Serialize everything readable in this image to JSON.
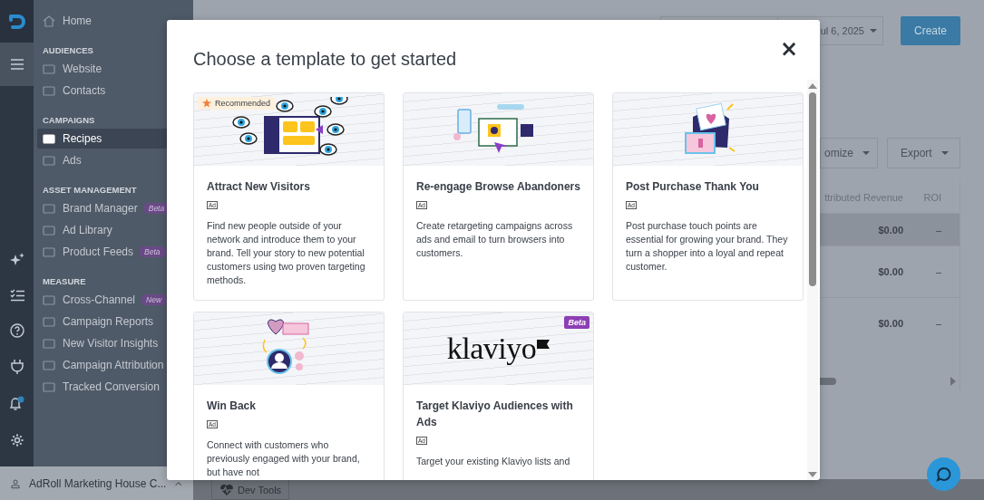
{
  "sidebar": {
    "home": "Home",
    "sections": [
      {
        "title": "AUDIENCES",
        "items": [
          {
            "label": "Website",
            "selected": false
          },
          {
            "label": "Contacts",
            "selected": false
          }
        ]
      },
      {
        "title": "CAMPAIGNS",
        "items": [
          {
            "label": "Recipes",
            "selected": true
          },
          {
            "label": "Ads",
            "selected": false
          }
        ]
      },
      {
        "title": "ASSET MANAGEMENT",
        "items": [
          {
            "label": "Brand Manager",
            "selected": false,
            "badge": "Beta"
          },
          {
            "label": "Ad Library",
            "selected": false
          },
          {
            "label": "Product Feeds",
            "selected": false,
            "badge": "Beta"
          }
        ]
      },
      {
        "title": "MEASURE",
        "items": [
          {
            "label": "Cross-Channel",
            "selected": false,
            "badge": "New"
          },
          {
            "label": "Campaign Reports",
            "selected": false
          },
          {
            "label": "New Visitor Insights",
            "selected": false
          },
          {
            "label": "Campaign Attribution",
            "selected": false
          },
          {
            "label": "Tracked Conversion",
            "selected": false
          }
        ]
      }
    ],
    "account": "AdRoll Marketing House C..."
  },
  "header": {
    "date": "ul 6, 2025",
    "create": "Create"
  },
  "toolbar": {
    "buttons": [
      "omize",
      "Export"
    ]
  },
  "table": {
    "columns": [
      "ttributed Revenue",
      "ROI"
    ],
    "rows": [
      {
        "cells": [
          "$0.00",
          "–"
        ],
        "selected": true
      },
      {
        "cells": [
          "$0.00",
          "–"
        ],
        "selected": false
      },
      {
        "cells": [
          "$0.00",
          "–"
        ],
        "selected": false
      }
    ]
  },
  "dev_tools": "Dev Tools",
  "modal": {
    "title": "Choose a template to get started",
    "close": "×",
    "cards": [
      {
        "kind": "eyes",
        "badge": {
          "kind": "recommended",
          "text": "Recommended"
        },
        "title": "Attract New Visitors",
        "tag": "Ad",
        "description": "Find new people outside of your network and introduce them to your brand. Tell your story to new potential customers using two proven targeting methods."
      },
      {
        "kind": "devices",
        "title": "Re-engage Browse Abandoners",
        "tag": "Ad",
        "description": "Create retargeting campaigns across ads and email to turn browsers into customers."
      },
      {
        "kind": "envelope",
        "title": "Post Purchase Thank You",
        "tag": "Ad",
        "description": "Post purchase touch points are essential for growing your brand. They turn a shopper into a loyal and repeat customer."
      },
      {
        "kind": "winback",
        "title": "Win Back",
        "tag": "Ad",
        "description": "Connect with customers who previously engaged with your brand, but have not"
      },
      {
        "kind": "logo",
        "logo_text": "klaviyo",
        "badge": {
          "kind": "beta",
          "text": "Beta"
        },
        "title": "Target Klaviyo Audiences with Ads",
        "tag": "Ad",
        "description": "Target your existing Klaviyo lists and"
      }
    ]
  }
}
